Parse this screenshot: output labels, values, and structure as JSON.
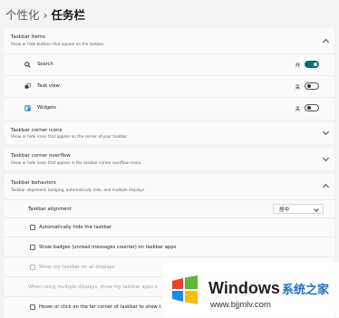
{
  "breadcrumb": {
    "parent": "个性化",
    "separator": "›",
    "current": "任务栏"
  },
  "taskbar_items": {
    "title": "Taskbar items",
    "subtitle": "Show or hide buttons that appear on the taskbar",
    "items": [
      {
        "label": "Search",
        "state": "开",
        "on": true,
        "icon": "search-icon"
      },
      {
        "label": "Task view",
        "state": "关",
        "on": false,
        "icon": "task-view-icon"
      },
      {
        "label": "Widgets",
        "state": "关",
        "on": false,
        "icon": "widgets-icon"
      }
    ]
  },
  "corner_icons": {
    "title": "Taskbar corner icons",
    "subtitle": "Show or hide icons that appear on the corner of your taskbar"
  },
  "corner_overflow": {
    "title": "Taskbar corner overflow",
    "subtitle": "Show or hide icons that appear in the taskbar corner overflow menu"
  },
  "behaviors": {
    "title": "Taskbar behaviors",
    "subtitle": "Taskbar alignment, badging, automatically hide, and multiple displays",
    "alignment_label": "Taskbar alignment",
    "alignment_value": "居中",
    "auto_hide": "Automatically hide the taskbar",
    "badges": "Show badges (unread messages counter) on taskbar apps",
    "all_displays": "Show my taskbar on all displays",
    "multi_display": "When using multiple displays, show my taskbar apps o",
    "hover_corner": "Hover or click on the far corner of taskbar to show t"
  },
  "watermark": {
    "brand": "Windows",
    "brand_cn": "系统之家",
    "url": "www.bjjmlv.com"
  },
  "colors": {
    "accent": "#0f6e74",
    "background": "#f3f3f3",
    "card": "#fbfbfb",
    "watermark_blue": "#1e6fc4"
  }
}
